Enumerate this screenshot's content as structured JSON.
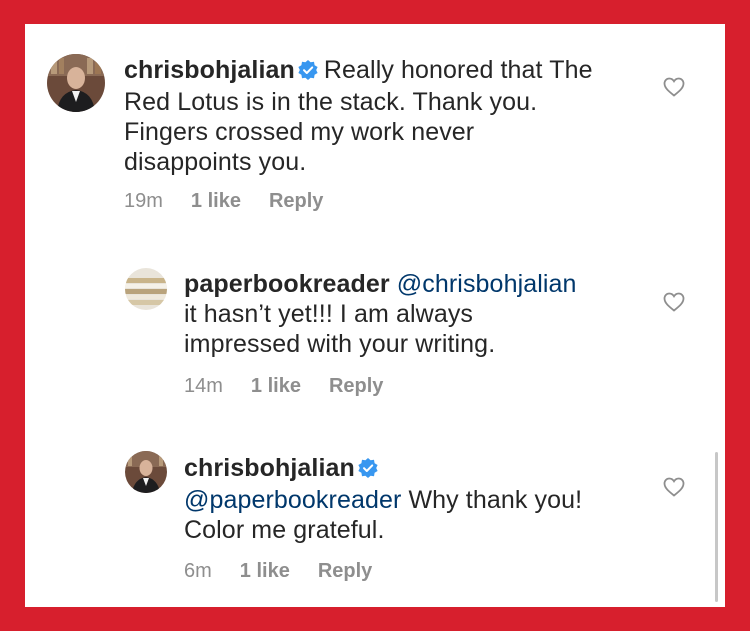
{
  "comments": [
    {
      "username": "chrisbohjalian",
      "verified": true,
      "text_lines": [
        "Really honored that The",
        "Red Lotus is in the stack. Thank you.",
        "Fingers crossed my work never",
        "disappoints you."
      ],
      "time": "19m",
      "likes": "1 like",
      "reply": "Reply"
    },
    {
      "username": "paperbookreader",
      "mention": "@chrisbohjalian",
      "text_lines": [
        "it hasn’t yet!!! I am always",
        "impressed with your writing."
      ],
      "time": "14m",
      "likes": "1 like",
      "reply": "Reply"
    },
    {
      "username": "chrisbohjalian",
      "verified": true,
      "mention": "@paperbookreader",
      "text_after_mention": "Why thank you!",
      "text_lines": [
        "Color me grateful."
      ],
      "time": "6m",
      "likes": "1 like",
      "reply": "Reply"
    }
  ],
  "colors": {
    "background_border": "#d71f2d",
    "text": "#262626",
    "mention": "#00376b",
    "meta": "#8e8e8e",
    "verified": "#3897f0"
  },
  "icons": [
    "verified-badge-icon",
    "heart-icon"
  ]
}
